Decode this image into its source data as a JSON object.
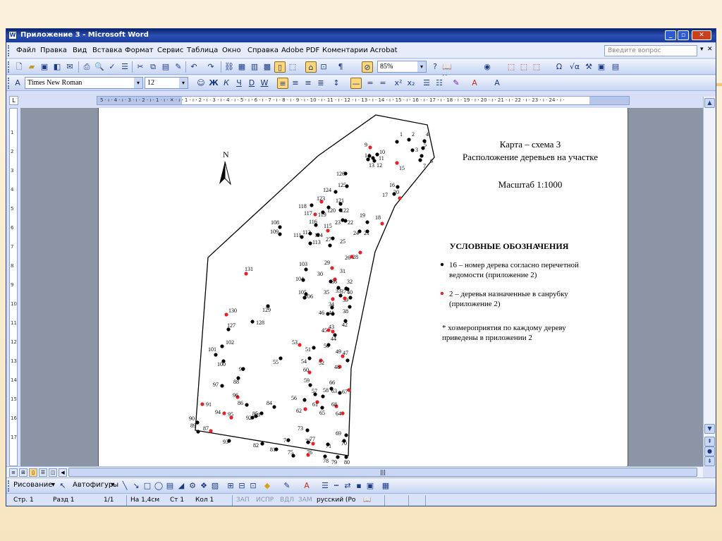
{
  "window": {
    "title": "Приложение 3 - Microsoft Word",
    "app_icon": "W",
    "buttons": {
      "minimize": "_",
      "restore": "▫",
      "close": "✕"
    }
  },
  "menu": {
    "items": [
      "Файл",
      "Правка",
      "Вид",
      "Вставка",
      "Формат",
      "Сервис",
      "Таблица",
      "Окно",
      "Справка",
      "Adobe PDF",
      "Коментарии Acrobat"
    ],
    "help_placeholder": "Введите вопрос",
    "close_doc": "✕"
  },
  "toolbar_standard": {
    "zoom": "85%",
    "reading_button": "Чтение"
  },
  "toolbar_format": {
    "style_icon": "A",
    "font": "Times New Roman",
    "size": "12",
    "bold": "Ж",
    "italic": "К",
    "underline": "Ч",
    "strike": "D",
    "double_underline": "W"
  },
  "ruler": {
    "text": "5 · ı · 4 · ı · 3 · ı · 2 · ı · 1 · ı · ✕ · ı · 1 · ı · 2 · ı · 3 · ı · 4 · ı · 5 · ı · 6 · ı · 7 · ı · 8 · ı · 9 · ı · 10 · ı · 11 · ı · 12 · ı · 13 · ı · 14 · ı · 15 · ı · 16 · ı · 17 · ı · 18 · ı · 19 · ı · 20 · ı · 21 · ı · 22 · ı · 23 · ı · 24 · ı ·",
    "vertical_marks": [
      "1",
      "2",
      "3",
      "4",
      "5",
      "6",
      "7",
      "8",
      "9",
      "10",
      "11",
      "12",
      "13",
      "14",
      "15",
      "16",
      "17"
    ]
  },
  "map": {
    "title_lines": [
      "Карта – схема 3",
      "Расположение деревьев на участке"
    ],
    "scale": "Масштаб 1:1000",
    "north": "N",
    "legend_heading": "УСЛОВНЫЕ ОБОЗНАЧЕНИЯ",
    "legend_black_lines": [
      "16 – номер дерева согласно перечетной",
      "ведомости (приложение 2)"
    ],
    "legend_red_lines": [
      "2 – деревья назначенные в санрубку",
      "(приложение 2)"
    ],
    "note_lines": [
      "* хозмероприятия по каждому дереву",
      "приведены в приложении 2"
    ],
    "colors": {
      "keep": "#000000",
      "fell": "#e8202a"
    },
    "trees": [
      {
        "n": "1",
        "c": "k"
      },
      {
        "n": "2",
        "c": "k"
      },
      {
        "n": "3",
        "c": "k"
      },
      {
        "n": "4",
        "c": "k"
      },
      {
        "n": "5",
        "c": "k"
      },
      {
        "n": "6",
        "c": "k"
      },
      {
        "n": "7",
        "c": "k"
      },
      {
        "n": "9",
        "c": "r"
      },
      {
        "n": "10",
        "c": "k"
      },
      {
        "n": "11",
        "c": "k"
      },
      {
        "n": "12",
        "c": "k"
      },
      {
        "n": "13",
        "c": "k"
      },
      {
        "n": "14",
        "c": "k"
      },
      {
        "n": "15",
        "c": "r"
      },
      {
        "n": "16",
        "c": "k"
      },
      {
        "n": "17",
        "c": "k"
      },
      {
        "n": "18",
        "c": "r"
      },
      {
        "n": "19",
        "c": "k"
      },
      {
        "n": "20",
        "c": "r"
      },
      {
        "n": "21",
        "c": "k"
      },
      {
        "n": "22",
        "c": "k"
      },
      {
        "n": "23",
        "c": "k"
      },
      {
        "n": "24",
        "c": "k"
      },
      {
        "n": "25",
        "c": "k"
      },
      {
        "n": "26",
        "c": "r"
      },
      {
        "n": "27",
        "c": "k"
      },
      {
        "n": "28",
        "c": "r"
      },
      {
        "n": "29",
        "c": "r"
      },
      {
        "n": "30",
        "c": "k"
      },
      {
        "n": "31",
        "c": "r"
      },
      {
        "n": "32",
        "c": "k"
      },
      {
        "n": "33",
        "c": "k"
      },
      {
        "n": "34",
        "c": "k"
      },
      {
        "n": "35",
        "c": "r"
      },
      {
        "n": "36",
        "c": "k"
      },
      {
        "n": "37",
        "c": "k"
      },
      {
        "n": "38",
        "c": "k"
      },
      {
        "n": "39",
        "c": "k"
      },
      {
        "n": "40",
        "c": "r"
      },
      {
        "n": "41",
        "c": "k"
      },
      {
        "n": "42",
        "c": "k"
      },
      {
        "n": "43",
        "c": "r"
      },
      {
        "n": "44",
        "c": "k"
      },
      {
        "n": "45",
        "c": "r"
      },
      {
        "n": "46",
        "c": "k"
      },
      {
        "n": "47",
        "c": "k"
      },
      {
        "n": "48",
        "c": "r"
      },
      {
        "n": "49",
        "c": "r"
      },
      {
        "n": "50",
        "c": "k"
      },
      {
        "n": "51",
        "c": "k"
      },
      {
        "n": "52",
        "c": "r"
      },
      {
        "n": "53",
        "c": "r"
      },
      {
        "n": "54",
        "c": "k"
      },
      {
        "n": "55",
        "c": "k"
      },
      {
        "n": "56",
        "c": "k"
      },
      {
        "n": "57",
        "c": "k"
      },
      {
        "n": "58",
        "c": "k"
      },
      {
        "n": "59",
        "c": "k"
      },
      {
        "n": "60",
        "c": "r"
      },
      {
        "n": "61",
        "c": "r"
      },
      {
        "n": "62",
        "c": "r"
      },
      {
        "n": "63",
        "c": "k"
      },
      {
        "n": "64",
        "c": "r"
      },
      {
        "n": "65",
        "c": "k"
      },
      {
        "n": "66",
        "c": "k"
      },
      {
        "n": "67",
        "c": "r"
      },
      {
        "n": "68",
        "c": "r"
      },
      {
        "n": "69",
        "c": "k"
      },
      {
        "n": "70",
        "c": "k"
      },
      {
        "n": "71",
        "c": "k"
      },
      {
        "n": "72",
        "c": "k"
      },
      {
        "n": "73",
        "c": "k"
      },
      {
        "n": "74",
        "c": "k"
      },
      {
        "n": "75",
        "c": "k"
      },
      {
        "n": "76",
        "c": "r"
      },
      {
        "n": "77",
        "c": "r"
      },
      {
        "n": "78",
        "c": "k"
      },
      {
        "n": "79",
        "c": "k"
      },
      {
        "n": "80",
        "c": "k"
      },
      {
        "n": "81",
        "c": "k"
      },
      {
        "n": "82",
        "c": "k"
      },
      {
        "n": "83",
        "c": "k"
      },
      {
        "n": "84",
        "c": "k"
      },
      {
        "n": "85",
        "c": "k"
      },
      {
        "n": "86",
        "c": "k"
      },
      {
        "n": "87",
        "c": "r"
      },
      {
        "n": "88",
        "c": "k"
      },
      {
        "n": "89",
        "c": "k"
      },
      {
        "n": "90",
        "c": "k"
      },
      {
        "n": "91",
        "c": "r"
      },
      {
        "n": "92",
        "c": "k"
      },
      {
        "n": "93",
        "c": "k"
      },
      {
        "n": "94",
        "c": "r"
      },
      {
        "n": "95",
        "c": "r"
      },
      {
        "n": "96",
        "c": "r"
      },
      {
        "n": "97",
        "c": "k"
      },
      {
        "n": "99",
        "c": "k"
      },
      {
        "n": "100",
        "c": "k"
      },
      {
        "n": "101",
        "c": "k"
      },
      {
        "n": "102",
        "c": "k"
      },
      {
        "n": "103",
        "c": "k"
      },
      {
        "n": "104",
        "c": "k"
      },
      {
        "n": "105",
        "c": "k"
      },
      {
        "n": "106",
        "c": "k"
      },
      {
        "n": "108",
        "c": "k"
      },
      {
        "n": "109",
        "c": "k"
      },
      {
        "n": "111",
        "c": "k"
      },
      {
        "n": "112",
        "c": "k"
      },
      {
        "n": "113",
        "c": "k"
      },
      {
        "n": "114",
        "c": "k"
      },
      {
        "n": "115",
        "c": "r"
      },
      {
        "n": "116",
        "c": "k"
      },
      {
        "n": "117",
        "c": "r"
      },
      {
        "n": "118",
        "c": "k"
      },
      {
        "n": "119",
        "c": "k"
      },
      {
        "n": "120",
        "c": "k"
      },
      {
        "n": "121",
        "c": "k"
      },
      {
        "n": "122",
        "c": "k"
      },
      {
        "n": "123",
        "c": "r"
      },
      {
        "n": "124",
        "c": "k"
      },
      {
        "n": "125",
        "c": "k"
      },
      {
        "n": "126",
        "c": "k"
      },
      {
        "n": "127",
        "c": "k"
      },
      {
        "n": "128",
        "c": "k"
      },
      {
        "n": "129",
        "c": "k"
      },
      {
        "n": "130",
        "c": "r"
      },
      {
        "n": "131",
        "c": "r"
      }
    ]
  },
  "draw_toolbar": {
    "draw_label": "Рисование",
    "autoshapes_label": "Автофигуры"
  },
  "status": {
    "page": "Стр. 1",
    "section": "Разд 1",
    "pages": "1/1",
    "position": "На 1,4см",
    "line": "Ст 1",
    "column": "Кол 1",
    "rec": "ЗАП",
    "trk": "ИСПР",
    "ext": "ВДЛ",
    "ovr": "ЗАМ",
    "language": "русский (Ро"
  }
}
